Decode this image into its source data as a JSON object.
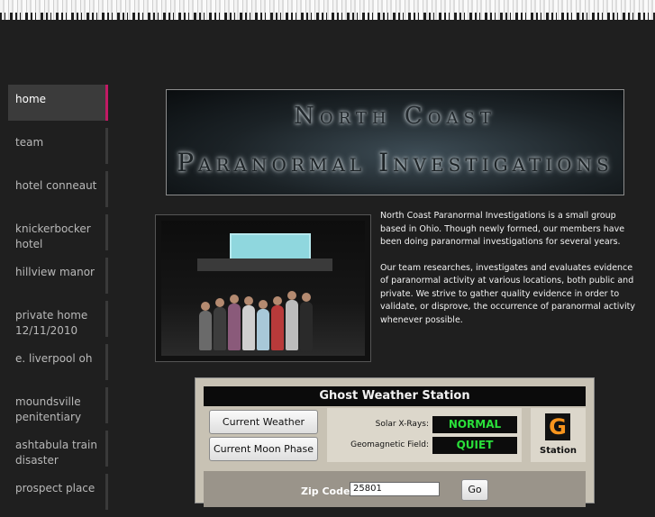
{
  "nav": {
    "items": [
      {
        "label": "home",
        "active": true
      },
      {
        "label": "team"
      },
      {
        "label": "hotel conneaut"
      },
      {
        "label": "knickerbocker hotel"
      },
      {
        "label": "hillview manor"
      },
      {
        "label": "private home 12/11/2010"
      },
      {
        "label": "e. liverpool oh"
      },
      {
        "label": "moundsville penitentiary"
      },
      {
        "label": "ashtabula train disaster"
      },
      {
        "label": "prospect place"
      }
    ]
  },
  "banner": {
    "line1": "North Coast",
    "line2": "Paranormal Investigations"
  },
  "description": {
    "p1": "North Coast Paranormal Investigations is a small group based in Ohio. Though newly formed, our members have been doing paranormal investigations for several years.",
    "p2": "Our team researches, investigates and evaluates evidence of paranormal activity at various locations, both public and private. We strive to gather quality evidence in order to validate, or disprove, the occurrence of paranormal activity whenever possible."
  },
  "weather": {
    "title": "Ghost Weather Station",
    "current_weather_label": "Current Weather",
    "moon_phase_label": "Current Moon Phase",
    "solar_label": "Solar X-Rays:",
    "solar_value": "NORMAL",
    "geomag_label": "Geomagnetic Field:",
    "geomag_value": "QUIET",
    "logo_letter": "G",
    "station_label": "Station",
    "zip_label": "Zip Code:",
    "zip_value": "25801",
    "go_label": "Go",
    "value_color": "#2ae03a"
  },
  "colors": {
    "accent": "#c21a64",
    "background": "#1f1f1f"
  }
}
